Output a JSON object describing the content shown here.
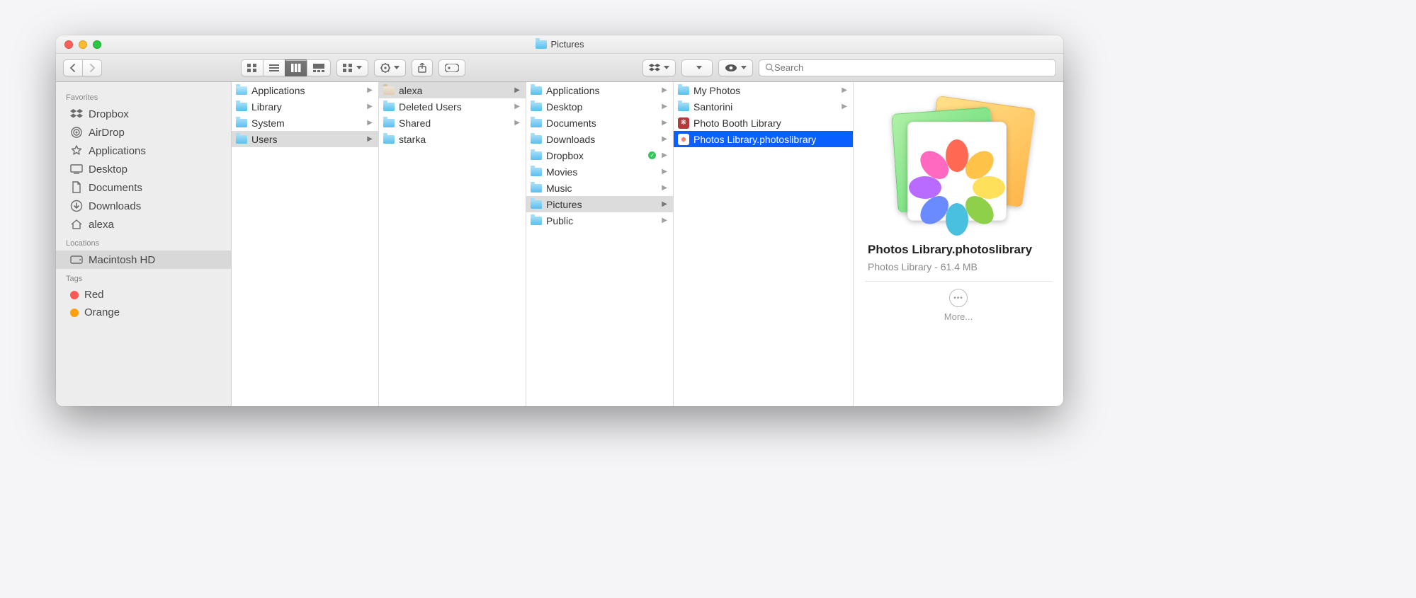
{
  "window": {
    "title": "Pictures"
  },
  "toolbar": {
    "search_placeholder": "Search"
  },
  "sidebar": {
    "sections": [
      {
        "header": "Favorites",
        "items": [
          {
            "label": "Dropbox",
            "icon": "dropbox"
          },
          {
            "label": "AirDrop",
            "icon": "airdrop"
          },
          {
            "label": "Applications",
            "icon": "applications"
          },
          {
            "label": "Desktop",
            "icon": "desktop"
          },
          {
            "label": "Documents",
            "icon": "documents"
          },
          {
            "label": "Downloads",
            "icon": "downloads"
          },
          {
            "label": "alexa",
            "icon": "home"
          }
        ]
      },
      {
        "header": "Locations",
        "items": [
          {
            "label": "Macintosh HD",
            "icon": "disk",
            "selected": true
          }
        ]
      },
      {
        "header": "Tags",
        "items": [
          {
            "label": "Red",
            "color": "#ff5a52"
          },
          {
            "label": "Orange",
            "color": "#ff9f0a"
          }
        ]
      }
    ]
  },
  "columns": [
    {
      "items": [
        {
          "label": "Applications",
          "icon": "folder-app",
          "arrow": true
        },
        {
          "label": "Library",
          "icon": "folder",
          "arrow": true
        },
        {
          "label": "System",
          "icon": "folder",
          "arrow": true
        },
        {
          "label": "Users",
          "icon": "folder",
          "arrow": true,
          "path": true
        }
      ]
    },
    {
      "items": [
        {
          "label": "alexa",
          "icon": "folder-home",
          "arrow": true,
          "path": true
        },
        {
          "label": "Deleted Users",
          "icon": "folder",
          "arrow": true
        },
        {
          "label": "Shared",
          "icon": "folder",
          "arrow": true
        },
        {
          "label": "starka",
          "icon": "folder",
          "arrow": false
        }
      ]
    },
    {
      "items": [
        {
          "label": "Applications",
          "icon": "folder",
          "arrow": true
        },
        {
          "label": "Desktop",
          "icon": "folder",
          "arrow": true
        },
        {
          "label": "Documents",
          "icon": "folder",
          "arrow": true
        },
        {
          "label": "Downloads",
          "icon": "folder",
          "arrow": true
        },
        {
          "label": "Dropbox",
          "icon": "folder",
          "arrow": true,
          "badge": true
        },
        {
          "label": "Movies",
          "icon": "folder",
          "arrow": true
        },
        {
          "label": "Music",
          "icon": "folder",
          "arrow": true
        },
        {
          "label": "Pictures",
          "icon": "folder",
          "arrow": true,
          "path": true
        },
        {
          "label": "Public",
          "icon": "folder",
          "arrow": true
        }
      ]
    },
    {
      "items": [
        {
          "label": "My Photos",
          "icon": "folder",
          "arrow": true
        },
        {
          "label": "Santorini",
          "icon": "folder",
          "arrow": true
        },
        {
          "label": "Photo Booth Library",
          "icon": "photobooth",
          "arrow": false
        },
        {
          "label": "Photos Library.photoslibrary",
          "icon": "photos",
          "arrow": false,
          "selected": true
        }
      ]
    }
  ],
  "preview": {
    "name": "Photos Library.photoslibrary",
    "kind": "Photos Library",
    "size": "61.4 MB",
    "more_label": "More..."
  },
  "colors": {
    "selection": "#0a60ff",
    "path": "#dcdcdc"
  }
}
